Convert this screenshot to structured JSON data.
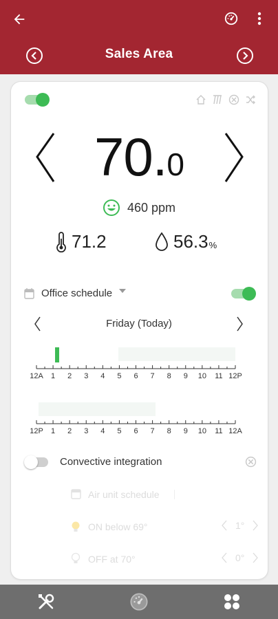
{
  "header": {
    "title": "Sales Area"
  },
  "thermostat": {
    "setpoint_whole": "70.",
    "setpoint_decimal": "0",
    "co2": "460 ppm",
    "temperature": "71.2",
    "humidity": "56.3",
    "humidity_unit": "%",
    "power_on": true
  },
  "schedule": {
    "name": "Office schedule",
    "enabled": true,
    "day": "Friday (Today)",
    "am_ticks": [
      "12A",
      "1",
      "2",
      "3",
      "4",
      "5",
      "6",
      "7",
      "8",
      "9",
      "10",
      "11",
      "12P"
    ],
    "pm_ticks": [
      "12P",
      "1",
      "2",
      "3",
      "4",
      "5",
      "6",
      "7",
      "8",
      "9",
      "10",
      "11",
      "12A"
    ]
  },
  "convective": {
    "label": "Convective integration",
    "enabled": false,
    "air_unit_schedule": "Air unit schedule",
    "on_below": "ON below 69°",
    "on_offset": "1°",
    "off_at": "OFF at 70°",
    "off_offset": "0°"
  },
  "colors": {
    "header": "#a32631",
    "accent_green": "#3dbb55",
    "tab_bar": "#6e6e6e"
  },
  "icons": {
    "back": "arrow-left-icon",
    "gauge": "gauge-icon",
    "menu": "more-vert-icon",
    "prev": "chevron-circle-left-icon",
    "next": "chevron-circle-right-icon",
    "tools": "tools-icon",
    "dashboard": "gauge-icon",
    "apps": "apps-icon"
  }
}
